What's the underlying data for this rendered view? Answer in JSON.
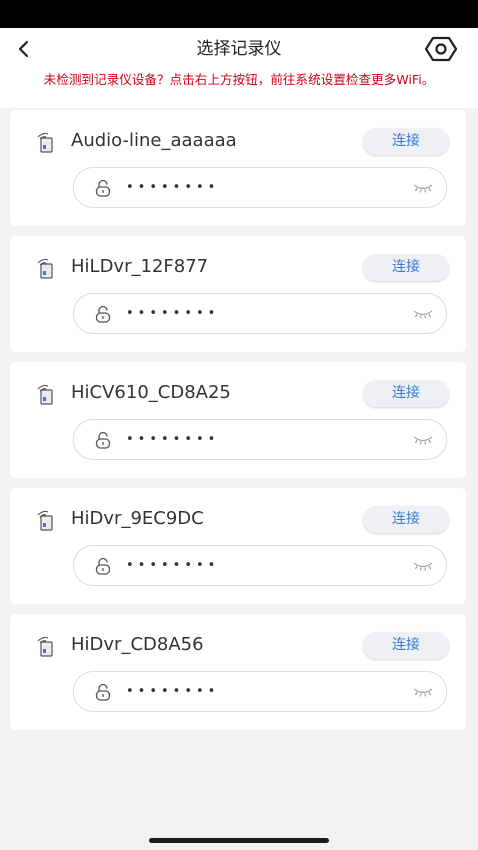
{
  "header": {
    "title": "选择记录仪"
  },
  "warning": {
    "text": "未检测到记录仪设备？点击右上方按钮，前往系统设置检查更多WiFi。",
    "color": "#d0021b"
  },
  "devices": [
    {
      "name": "Audio-line_aaaaaa",
      "connect_label": "连接",
      "password": "••••••••"
    },
    {
      "name": "HiLDvr_12F877",
      "connect_label": "连接",
      "password": "••••••••"
    },
    {
      "name": "HiCV610_CD8A25",
      "connect_label": "连接",
      "password": "••••••••"
    },
    {
      "name": "HiDvr_9EC9DC",
      "connect_label": "连接",
      "password": "••••••••"
    },
    {
      "name": "HiDvr_CD8A56",
      "connect_label": "连接",
      "password": "••••••••"
    }
  ],
  "icons": {
    "back": "chevron-left-icon",
    "settings": "gear-icon",
    "device": "wifi-device-icon",
    "lock": "lock-icon",
    "eye": "eye-closed-icon"
  },
  "colors": {
    "accent": "#3a7bd5",
    "background": "#f2f2f2"
  }
}
